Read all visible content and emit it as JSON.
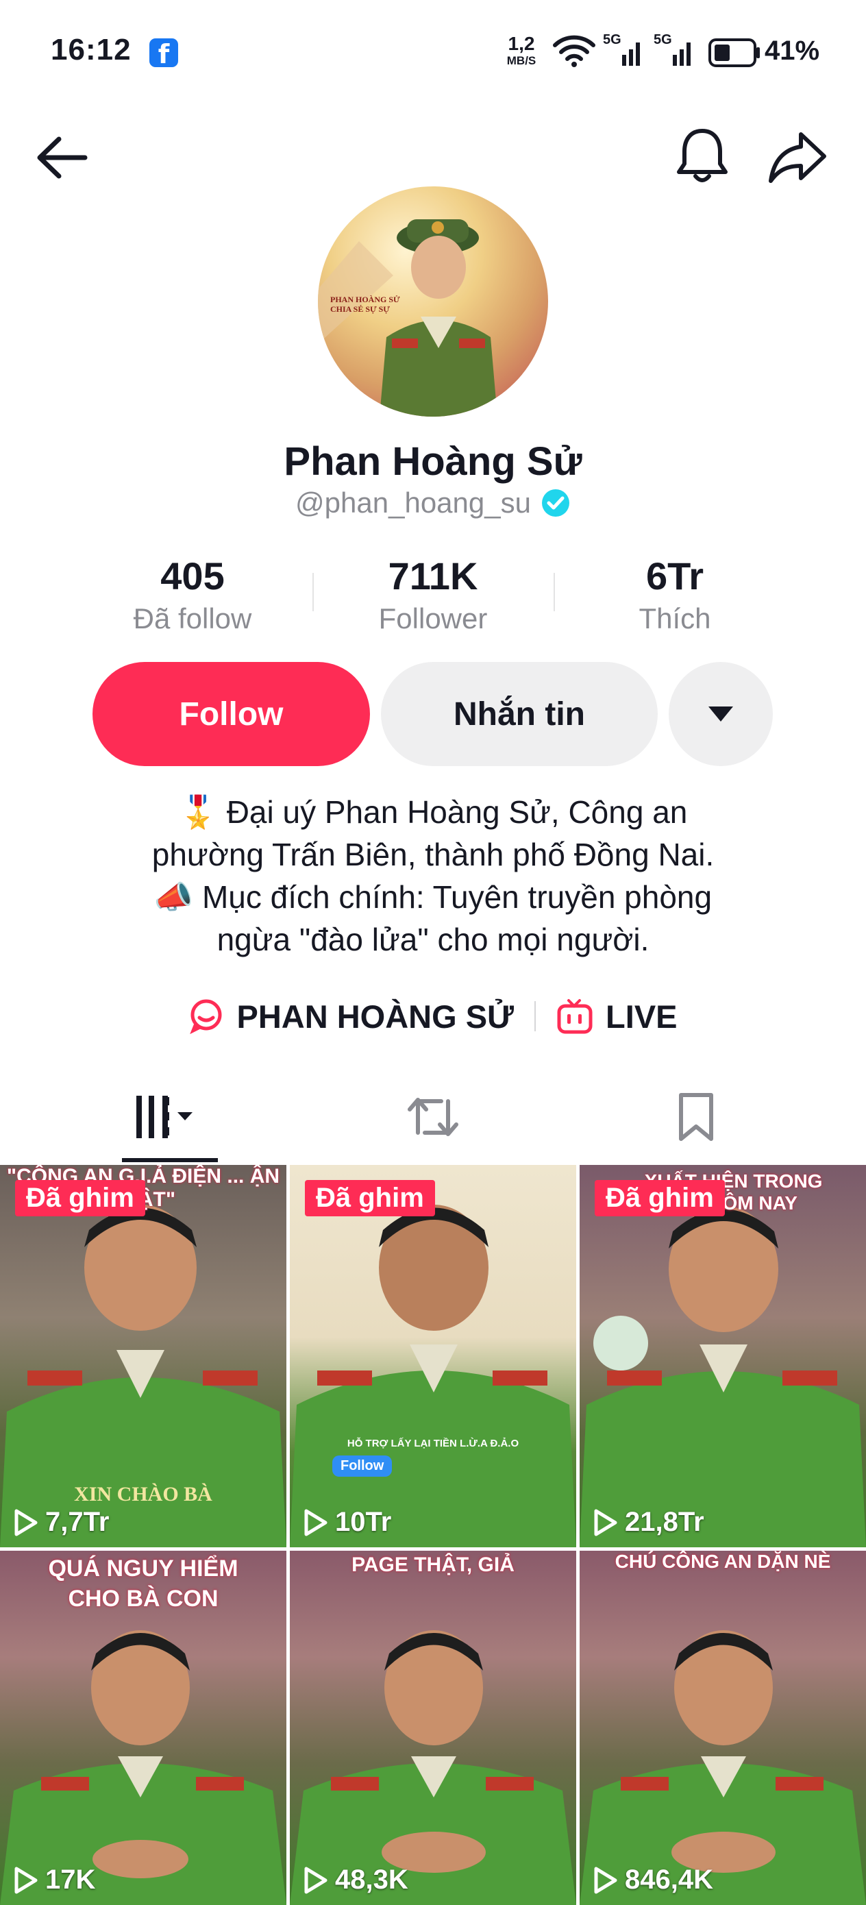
{
  "status_bar": {
    "time": "16:12",
    "app_badge": "f",
    "net_speed": "1,2",
    "net_unit": "MB/S",
    "battery": "41%",
    "icons": [
      "facebook-icon",
      "wifi-icon",
      "signal-5g-icon",
      "signal-5g-icon",
      "battery-icon"
    ]
  },
  "nav": {
    "back_icon": "back-arrow-icon",
    "bell_icon": "bell-icon",
    "share_icon": "share-icon"
  },
  "profile": {
    "avatar_text_line1": "PHAN HOÀNG SỬ",
    "avatar_text_line2": "CHIA SẺ SỰ SỰ",
    "name": "Phan Hoàng Sử",
    "handle": "@phan_hoang_su",
    "verified_icon": "verified-badge-icon"
  },
  "stats": [
    {
      "value": "405",
      "label": "Đã follow"
    },
    {
      "value": "711K",
      "label": "Follower"
    },
    {
      "value": "6Tr",
      "label": "Thích"
    }
  ],
  "actions": {
    "follow": "Follow",
    "message": "Nhắn tin",
    "more_icon": "caret-down-icon"
  },
  "bio": [
    "🎖️  Đại uý Phan Hoàng Sử, Công an",
    "phường Trấn Biên, thành phố Đồng Nai.",
    "📣 Mục đích chính: Tuyên truyền phòng",
    "ngừa \"đào lửa\" cho mọi người."
  ],
  "links": [
    {
      "label": "PHAN HOÀNG SỬ",
      "icon": "chat-bubble-icon"
    },
    {
      "label": "LIVE",
      "icon": "live-tv-icon"
    }
  ],
  "tabs": [
    {
      "name": "videos",
      "icon": "grid-bars-icon",
      "active": true
    },
    {
      "name": "reposts",
      "icon": "repost-icon",
      "active": false
    },
    {
      "name": "saved",
      "icon": "bookmark-icon",
      "active": false
    }
  ],
  "colors": {
    "accent": "#fe2c55",
    "muted_text": "#8a8b91",
    "button_grey": "#efeff0",
    "verified": "#20d5ec"
  },
  "videos": [
    {
      "pinned": "Đã ghim",
      "caption": "\"CÔNG AN G.I.Ả ĐIỆN ... ẬN THẬT\"",
      "overlay": "XIN CHÀO BÀ",
      "views": "7,7Tr"
    },
    {
      "pinned": "Đã ghim",
      "caption": "",
      "overlay": "HỖ TRỢ LẤY LẠI TIỀN L.Ừ.A Đ.Ả.O",
      "follow_chip": "Follow",
      "views": "10Tr"
    },
    {
      "pinned": "Đã ghim",
      "caption": "... XUẤT HIỆN TRONG NGÀY HÔM NAY",
      "overlay": "",
      "views": "21,8Tr"
    },
    {
      "pinned": "",
      "caption": "QUÁ NGUY HIỂM CHO BÀ CON",
      "overlay": "",
      "views": "17K"
    },
    {
      "pinned": "",
      "caption": "PAGE THẬT, GIẢ",
      "overlay": "",
      "views": "48,3K"
    },
    {
      "pinned": "",
      "caption": "CHÚ CÔNG AN DẶN NÈ",
      "overlay": "",
      "views": "846,4K"
    }
  ]
}
